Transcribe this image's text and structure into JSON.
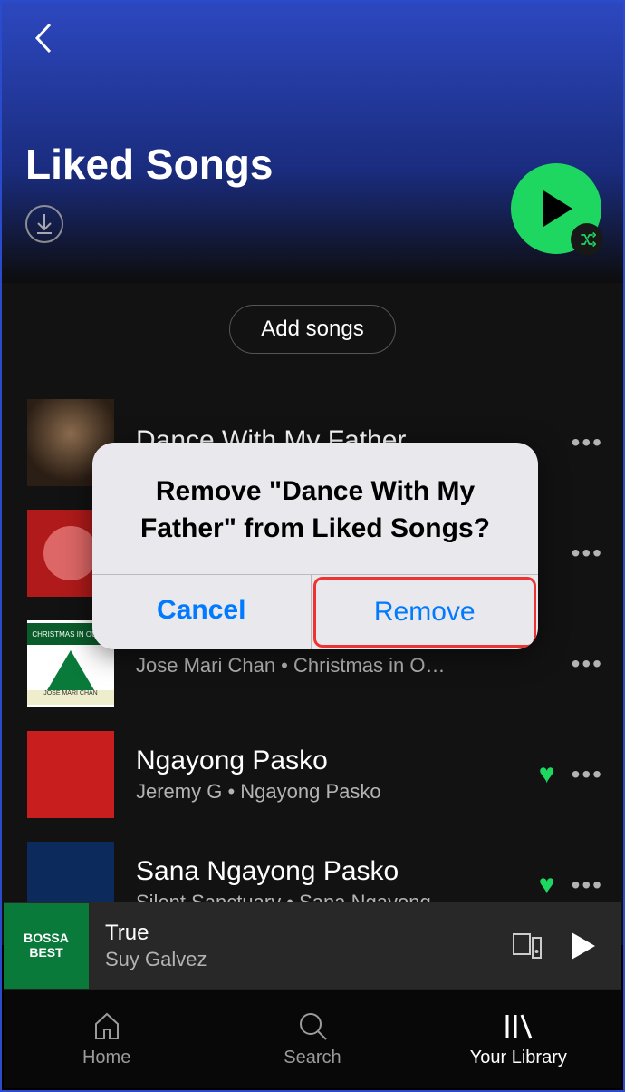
{
  "header": {
    "title": "Liked Songs"
  },
  "buttons": {
    "add_songs": "Add songs"
  },
  "tracks": [
    {
      "title": "Dance With My Father",
      "sub": "",
      "liked": false
    },
    {
      "title": "",
      "sub": "",
      "liked": false
    },
    {
      "title": "",
      "sub": "Jose Mari Chan • Christmas in O…",
      "liked": false
    },
    {
      "title": "Ngayong Pasko",
      "sub": "Jeremy G • Ngayong Pasko",
      "liked": true
    },
    {
      "title": "Sana Ngayong Pasko",
      "sub": "Silent Sanctuary • Sana Ngayong…",
      "liked": true
    }
  ],
  "nowplaying": {
    "title": "True",
    "artist": "Suy Galvez",
    "art_text1": "BOSSA",
    "art_text2": "BEST"
  },
  "nav": {
    "home": "Home",
    "search": "Search",
    "library": "Your Library"
  },
  "modal": {
    "message": "Remove \"Dance With My Father\" from Liked Songs?",
    "cancel": "Cancel",
    "remove": "Remove"
  },
  "art3": {
    "top": "CHRISTMAS IN OUR H",
    "bot": "JOSE MARI CHAN"
  }
}
